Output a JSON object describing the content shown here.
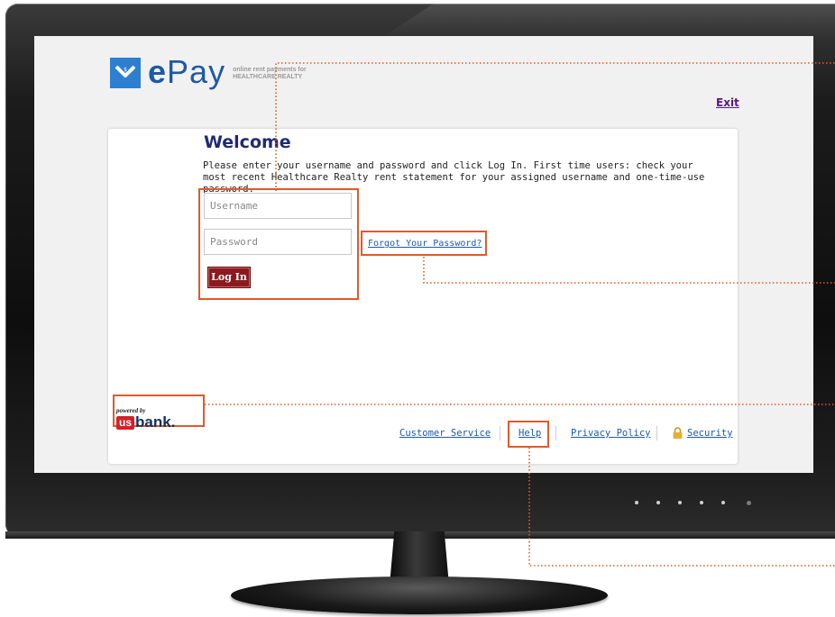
{
  "brand": {
    "name_bold": "e",
    "name_rest": "Pay",
    "tagline_line1": "online rent payments for",
    "tagline_line2": "HEALTHCARE REALTY",
    "icon": "epay-logo-icon"
  },
  "header": {
    "exit_label": "Exit"
  },
  "login": {
    "title": "Welcome",
    "intro": "Please enter your username and password and click Log In. First time users: check your most recent Healthcare Realty rent statement for your assigned username and one-time-use password.",
    "username_placeholder": "Username",
    "password_placeholder": "Password",
    "login_label": "Log In",
    "forgot_label": "Forgot Your Password?"
  },
  "powered_by": {
    "label": "powered by",
    "us": "us",
    "bank": "bank."
  },
  "footer": {
    "customer_service": "Customer Service",
    "help": "Help",
    "privacy_policy": "Privacy Policy",
    "security": "Security",
    "security_icon": "lock-icon"
  },
  "colors": {
    "brand_blue": "#1d5aa5",
    "title_navy": "#1f2a70",
    "button_red": "#8b1a1f",
    "link_blue": "#1c58b0",
    "highlight_orange": "#e05a2b"
  }
}
